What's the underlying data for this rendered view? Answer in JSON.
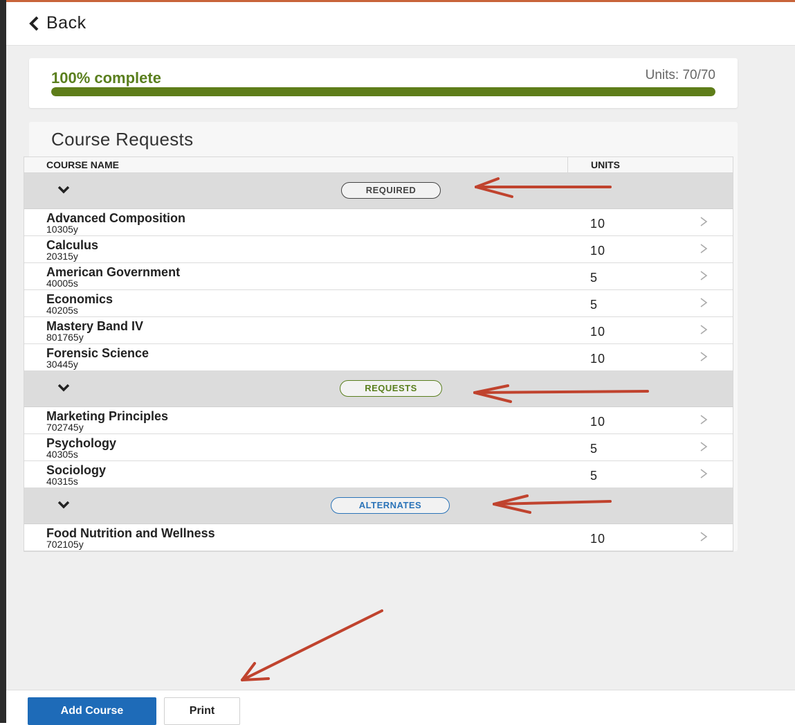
{
  "header": {
    "back_label": "Back"
  },
  "progress": {
    "label": "100% complete",
    "units_text": "Units: 70/70",
    "fraction": 1.0,
    "color": "#5e7d19"
  },
  "course_requests": {
    "title": "Course Requests",
    "columns": {
      "name": "COURSE NAME",
      "units": "UNITS"
    },
    "groups": [
      {
        "label": "REQUIRED",
        "color": "#444444",
        "courses": [
          {
            "name": "Advanced Composition",
            "code": "10305y",
            "units": "10"
          },
          {
            "name": "Calculus",
            "code": "20315y",
            "units": "10"
          },
          {
            "name": "American Government",
            "code": "40005s",
            "units": "5"
          },
          {
            "name": "Economics",
            "code": "40205s",
            "units": "5"
          },
          {
            "name": "Mastery Band IV",
            "code": "801765y",
            "units": "10"
          },
          {
            "name": "Forensic Science",
            "code": "30445y",
            "units": "10"
          }
        ]
      },
      {
        "label": "REQUESTS",
        "color": "#5a7f1e",
        "courses": [
          {
            "name": "Marketing Principles",
            "code": "702745y",
            "units": "10"
          },
          {
            "name": "Psychology",
            "code": "40305s",
            "units": "5"
          },
          {
            "name": "Sociology",
            "code": "40315s",
            "units": "5"
          }
        ]
      },
      {
        "label": "ALTERNATES",
        "color": "#2a73b8",
        "courses": [
          {
            "name": "Food Nutrition and Wellness",
            "code": "702105y",
            "units": "10"
          }
        ]
      }
    ]
  },
  "footer": {
    "add_course_label": "Add Course",
    "print_label": "Print"
  },
  "annotation_color": "#c0432e"
}
